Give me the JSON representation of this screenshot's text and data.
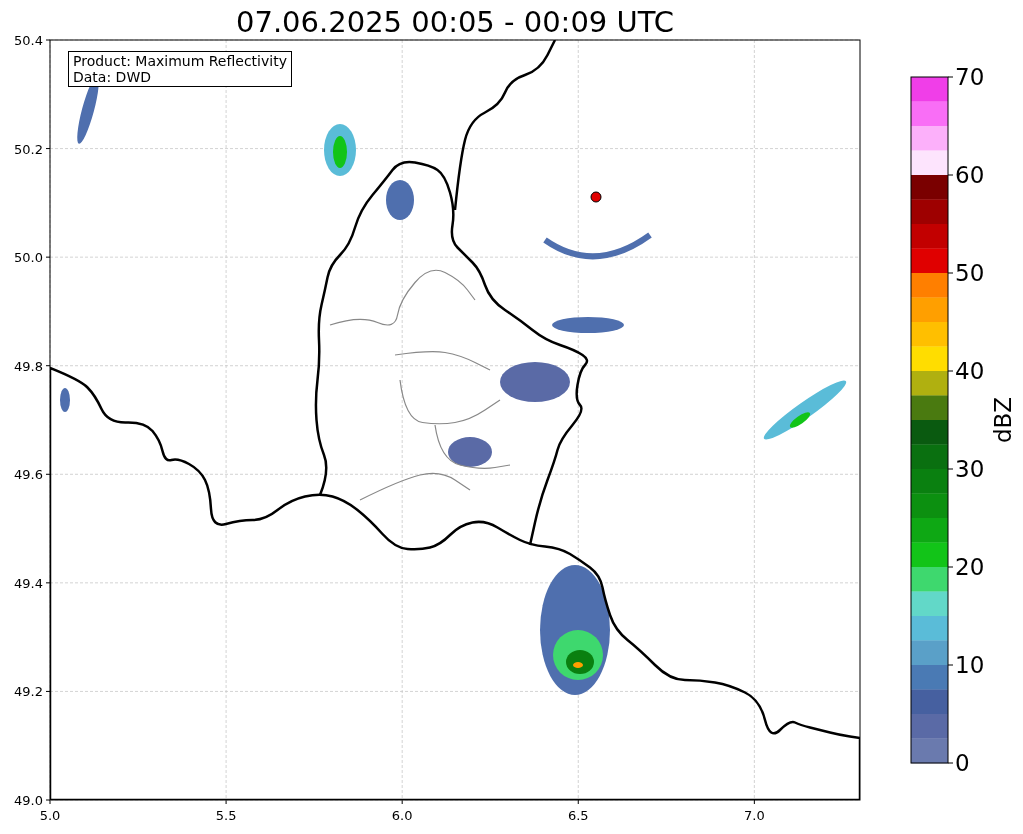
{
  "title": "07.06.2025 00:05 - 00:09 UTC",
  "map": {
    "info_box": [
      "Product: Maximum Reflectivity",
      "Data: DWD"
    ],
    "xticks": [
      "5.0",
      "5.5",
      "6.0",
      "6.5",
      "7.0"
    ],
    "yticks": [
      "50.4",
      "50.2",
      "50.0",
      "49.8",
      "49.6",
      "49.4",
      "49.2",
      "49.0"
    ]
  },
  "colorbar": {
    "label": "dBZ",
    "ticks": [
      "70",
      "60",
      "50",
      "40",
      "30",
      "20",
      "10",
      "0"
    ],
    "bins": [
      {
        "color": "#f03ee8"
      },
      {
        "color": "#f96ef6"
      },
      {
        "color": "#fcb0fa"
      },
      {
        "color": "#fde4fd"
      },
      {
        "color": "#7a0000"
      },
      {
        "color": "#9e0000"
      },
      {
        "color": "#c20000"
      },
      {
        "color": "#e00000"
      },
      {
        "color": "#ff7f00"
      },
      {
        "color": "#ff9f00"
      },
      {
        "color": "#ffbf00"
      },
      {
        "color": "#ffdd00"
      },
      {
        "color": "#b0b010"
      },
      {
        "color": "#4a7a10"
      },
      {
        "color": "#0a5a10"
      },
      {
        "color": "#0a7010"
      },
      {
        "color": "#0a8010"
      },
      {
        "color": "#0c9010"
      },
      {
        "color": "#0ea814"
      },
      {
        "color": "#12c418"
      },
      {
        "color": "#3ed86e"
      },
      {
        "color": "#62d8c8"
      },
      {
        "color": "#5abcd8"
      },
      {
        "color": "#5aa0c8"
      },
      {
        "color": "#4a7ab4"
      },
      {
        "color": "#4660a0"
      },
      {
        "color": "#5a6aa6"
      },
      {
        "color": "#6a7aae"
      }
    ]
  }
}
